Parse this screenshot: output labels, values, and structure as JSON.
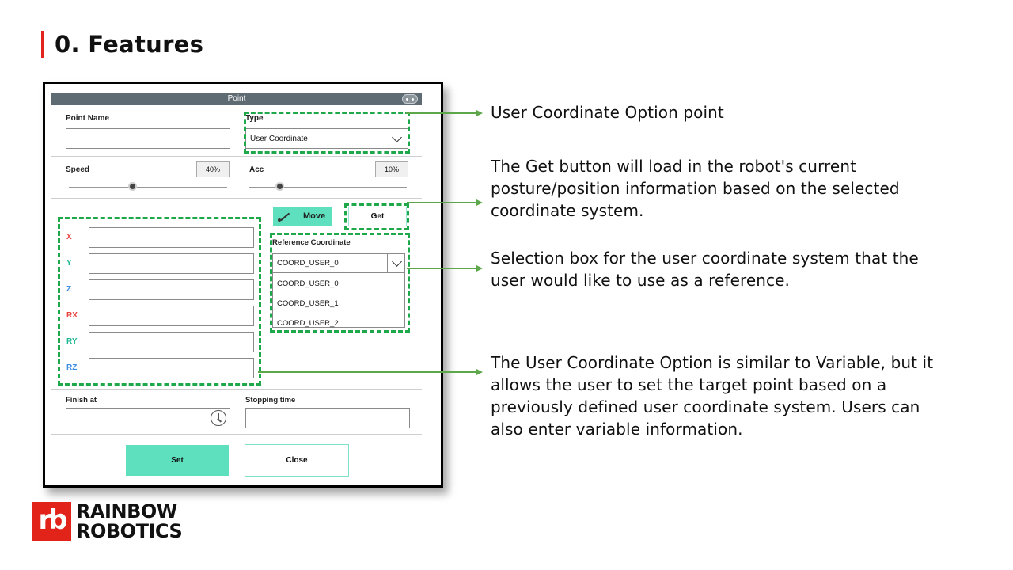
{
  "slide": {
    "title": "0. Features"
  },
  "dialog": {
    "title": "Point",
    "point_name_label": "Point Name",
    "point_name_value": "",
    "type_label": "Type",
    "type_value": "User Coordinate",
    "speed_label": "Speed",
    "speed_value": "40%",
    "speed_level": 0.4,
    "acc_label": "Acc",
    "acc_value": "10%",
    "acc_level": 0.1,
    "move_label": "Move",
    "get_label": "Get",
    "coords": [
      {
        "label": "X",
        "color": "#e8413c",
        "value": ""
      },
      {
        "label": "Y",
        "color": "#1fb892",
        "value": ""
      },
      {
        "label": "Z",
        "color": "#3b8de0",
        "value": ""
      },
      {
        "label": "RX",
        "color": "#e8413c",
        "value": ""
      },
      {
        "label": "RY",
        "color": "#1fb892",
        "value": ""
      },
      {
        "label": "RZ",
        "color": "#3b8de0",
        "value": ""
      }
    ],
    "reference_label": "Reference Coordinate",
    "reference_value": "COORD_USER_0",
    "reference_options": [
      "COORD_USER_0",
      "COORD_USER_1",
      "COORD_USER_2"
    ],
    "finish_label": "Finish at",
    "stopping_label": "Stopping time",
    "set_label": "Set",
    "close_label": "Close"
  },
  "annotations": {
    "a1": "User Coordinate Option point",
    "a2_line1": "The Get button will load in the robot's current",
    "a2_line2": "posture/position information based on the selected",
    "a2_line3": "coordinate system.",
    "a3_line1": "Selection box for the user coordinate system that the",
    "a3_line2": "user would like to use as a reference.",
    "a4_line1": "The User Coordinate Option is similar to Variable, but it",
    "a4_line2": "allows the user to set the target point based on a",
    "a4_line3": "previously defined user coordinate system. Users can",
    "a4_line4": "also enter variable information."
  },
  "logo": {
    "mark": "rb",
    "line1": "RAINBOW",
    "line2": "ROBOTICS"
  },
  "colors": {
    "accent_red": "#e2231a",
    "mint": "#5ee0bf",
    "dash_green": "#1ea84a",
    "callout_green": "#5da64a"
  },
  "icons": [
    "gamepad-icon",
    "chevron-down-icon",
    "move-path-icon",
    "clock-icon"
  ]
}
